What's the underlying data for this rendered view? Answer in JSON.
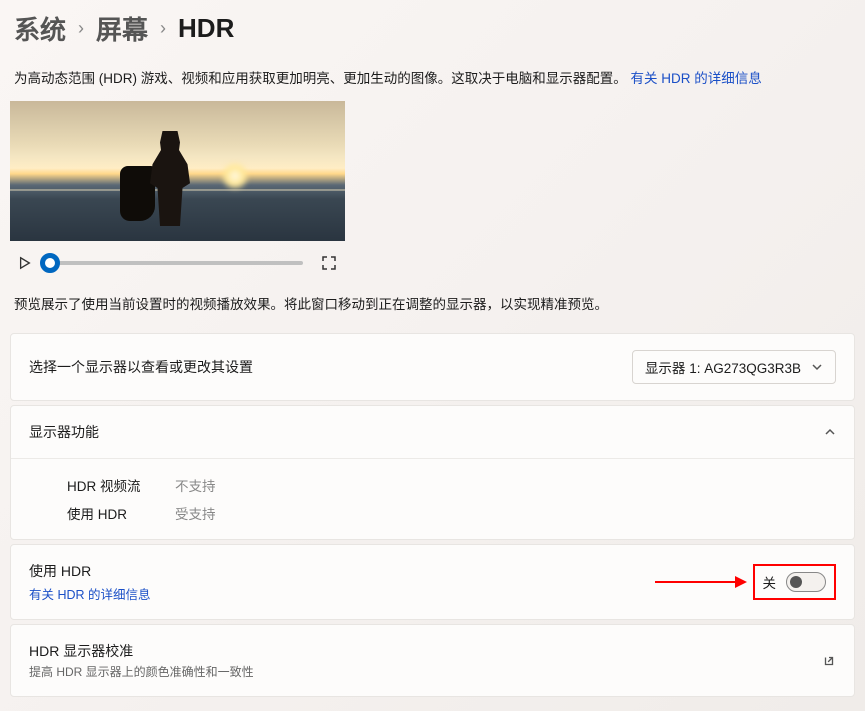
{
  "breadcrumb": {
    "level1": "系统",
    "level2": "屏幕",
    "level3": "HDR"
  },
  "description": {
    "text": "为高动态范围 (HDR) 游戏、视频和应用获取更加明亮、更加生动的图像。这取决于电脑和显示器配置。",
    "link": "有关 HDR 的详细信息"
  },
  "preview_desc": "预览展示了使用当前设置时的视频播放效果。将此窗口移动到正在调整的显示器，以实现精准预览。",
  "display_select": {
    "label": "选择一个显示器以查看或更改其设置",
    "selected": "显示器 1: AG273QG3R3B"
  },
  "capabilities": {
    "title": "显示器功能",
    "rows": [
      {
        "label": "HDR 视频流",
        "value": "不支持"
      },
      {
        "label": "使用 HDR",
        "value": "受支持"
      }
    ]
  },
  "use_hdr": {
    "title": "使用 HDR",
    "link": "有关 HDR 的详细信息",
    "state": "关"
  },
  "calibration": {
    "title": "HDR 显示器校准",
    "subtitle": "提高 HDR 显示器上的颜色准确性和一致性"
  }
}
